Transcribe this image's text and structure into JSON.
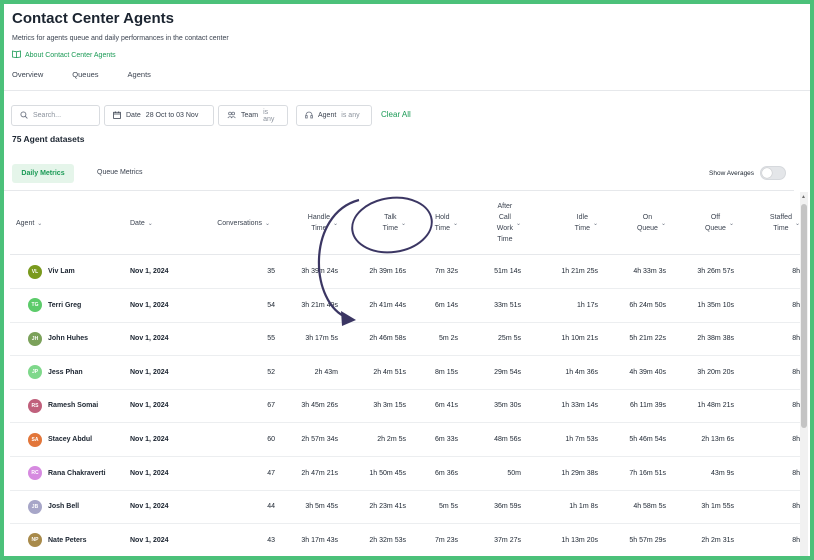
{
  "page": {
    "title": "Contact Center Agents",
    "subtitle": "Metrics for agents queue and daily performances in the contact center",
    "about_link": "About Contact Center Agents"
  },
  "nav": {
    "tabs": [
      "Overview",
      "Queues",
      "Agents"
    ]
  },
  "filters": {
    "search_placeholder": "Search...",
    "date_label": "Date",
    "date_value": "28 Oct to 03 Nov",
    "team_label": "Team",
    "team_value": "is any",
    "agent_label": "Agent",
    "agent_value": "is any",
    "clear_all": "Clear All"
  },
  "datasets_count": "75 Agent datasets",
  "view_tabs": {
    "daily": "Daily Metrics",
    "queue": "Queue Metrics"
  },
  "show_averages": {
    "label": "Show Averages",
    "on": false
  },
  "columns": [
    {
      "key": "agent",
      "lines": [
        "Agent"
      ]
    },
    {
      "key": "date",
      "lines": [
        "Date"
      ]
    },
    {
      "key": "conversations",
      "lines": [
        "Conversations"
      ]
    },
    {
      "key": "handle",
      "lines": [
        "Handle",
        "Time"
      ]
    },
    {
      "key": "talk",
      "lines": [
        "Talk",
        "Time"
      ]
    },
    {
      "key": "hold",
      "lines": [
        "Hold",
        "Time"
      ]
    },
    {
      "key": "acw",
      "lines": [
        "After",
        "Call",
        "Work",
        "Time"
      ]
    },
    {
      "key": "idle",
      "lines": [
        "Idle",
        "Time"
      ]
    },
    {
      "key": "onqueue",
      "lines": [
        "On",
        "Queue"
      ]
    },
    {
      "key": "offqueue",
      "lines": [
        "Off",
        "Queue"
      ]
    },
    {
      "key": "staffed",
      "lines": [
        "Staffed",
        "Time"
      ]
    }
  ],
  "rows": [
    {
      "initials": "VL",
      "color": "#7a9a1e",
      "agent": "Viv Lam",
      "date": "Nov 1, 2024",
      "conversations": "35",
      "handle": "3h 39m 24s",
      "talk": "2h 39m 16s",
      "hold": "7m 32s",
      "acw": "51m 14s",
      "idle": "1h 21m 25s",
      "onqueue": "4h 33m 3s",
      "offqueue": "3h 26m 57s",
      "staffed": "8h"
    },
    {
      "initials": "TG",
      "color": "#5ccb6a",
      "agent": "Terri Greg",
      "date": "Nov 1, 2024",
      "conversations": "54",
      "handle": "3h 21m 49s",
      "talk": "2h 41m 44s",
      "hold": "6m 14s",
      "acw": "33m 51s",
      "idle": "1h 17s",
      "onqueue": "6h 24m 50s",
      "offqueue": "1h 35m 10s",
      "staffed": "8h"
    },
    {
      "initials": "JH",
      "color": "#7ba15a",
      "agent": "John Huhes",
      "date": "Nov 1, 2024",
      "conversations": "55",
      "handle": "3h 17m 5s",
      "talk": "2h 46m 58s",
      "hold": "5m 2s",
      "acw": "25m 5s",
      "idle": "1h 10m 21s",
      "onqueue": "5h 21m 22s",
      "offqueue": "2h 38m 38s",
      "staffed": "8h"
    },
    {
      "initials": "JP",
      "color": "#7fd88b",
      "agent": "Jess Phan",
      "date": "Nov 1, 2024",
      "conversations": "52",
      "handle": "2h 43m",
      "talk": "2h 4m 51s",
      "hold": "8m 15s",
      "acw": "29m 54s",
      "idle": "1h 4m 36s",
      "onqueue": "4h 39m 40s",
      "offqueue": "3h 20m 20s",
      "staffed": "8h"
    },
    {
      "initials": "RS",
      "color": "#c0607c",
      "agent": "Ramesh Somai",
      "date": "Nov 1, 2024",
      "conversations": "67",
      "handle": "3h 45m 26s",
      "talk": "3h 3m 15s",
      "hold": "6m 41s",
      "acw": "35m 30s",
      "idle": "1h 33m 14s",
      "onqueue": "6h 11m 39s",
      "offqueue": "1h 48m 21s",
      "staffed": "8h"
    },
    {
      "initials": "SA",
      "color": "#e2763a",
      "agent": "Stacey Abdul",
      "date": "Nov 1, 2024",
      "conversations": "60",
      "handle": "2h 57m 34s",
      "talk": "2h 2m 5s",
      "hold": "6m 33s",
      "acw": "48m 56s",
      "idle": "1h 7m 53s",
      "onqueue": "5h 46m 54s",
      "offqueue": "2h 13m 6s",
      "staffed": "8h"
    },
    {
      "initials": "RC",
      "color": "#d68ae0",
      "agent": "Rana Chakraverti",
      "date": "Nov 1, 2024",
      "conversations": "47",
      "handle": "2h 47m 21s",
      "talk": "1h 50m 45s",
      "hold": "6m 36s",
      "acw": "50m",
      "idle": "1h 29m 38s",
      "onqueue": "7h 16m 51s",
      "offqueue": "43m 9s",
      "staffed": "8h"
    },
    {
      "initials": "JB",
      "color": "#a7a6c8",
      "agent": "Josh Bell",
      "date": "Nov 1, 2024",
      "conversations": "44",
      "handle": "3h 5m 45s",
      "talk": "2h 23m 41s",
      "hold": "5m 5s",
      "acw": "36m 59s",
      "idle": "1h 1m 8s",
      "onqueue": "4h 58m 5s",
      "offqueue": "3h 1m 55s",
      "staffed": "8h"
    },
    {
      "initials": "NP",
      "color": "#a88a4a",
      "agent": "Nate Peters",
      "date": "Nov 1, 2024",
      "conversations": "43",
      "handle": "3h 17m 43s",
      "talk": "2h 32m 53s",
      "hold": "7m 23s",
      "acw": "37m 27s",
      "idle": "1h 13m 20s",
      "onqueue": "5h 57m 29s",
      "offqueue": "2h 2m 31s",
      "staffed": "8h"
    }
  ],
  "colors": {
    "accent": "#1a9a55",
    "frame": "#4cc17a",
    "annotation": "#3b3663"
  }
}
